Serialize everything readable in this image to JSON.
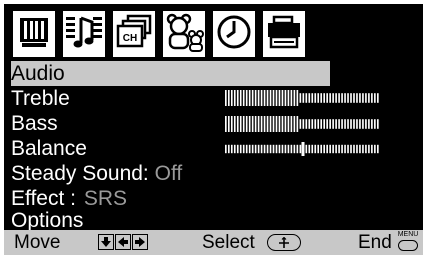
{
  "tabs": [
    {
      "icon": "picture-icon",
      "active": false
    },
    {
      "icon": "audio-icon",
      "active": true
    },
    {
      "icon": "channel-icon",
      "label": "CH",
      "active": false
    },
    {
      "icon": "parental-icon",
      "active": false
    },
    {
      "icon": "timer-icon",
      "active": false
    },
    {
      "icon": "setup-icon",
      "active": false
    }
  ],
  "menu": {
    "title": "Audio",
    "treble_label": "Treble",
    "bass_label": "Bass",
    "balance_label": "Balance",
    "steady_label": "Steady Sound:",
    "steady_value": "Off",
    "effect_label": "Effect",
    "effect_sep": ":",
    "effect_value": "SRS",
    "options_label": "Options"
  },
  "levels": {
    "treble": 0.48,
    "bass": 0.48,
    "balance": 0.5
  },
  "help": {
    "move_label": "Move",
    "move_keys": [
      "down-arrow-icon",
      "left-arrow-icon",
      "right-arrow-icon"
    ],
    "select_label": "Select",
    "end_label": "End",
    "menu_key_label": "MENU"
  },
  "colors": {
    "background": "#000000",
    "highlight": "#c8c8c8",
    "value_dim": "#9a9a9a",
    "text": "#ffffff"
  }
}
